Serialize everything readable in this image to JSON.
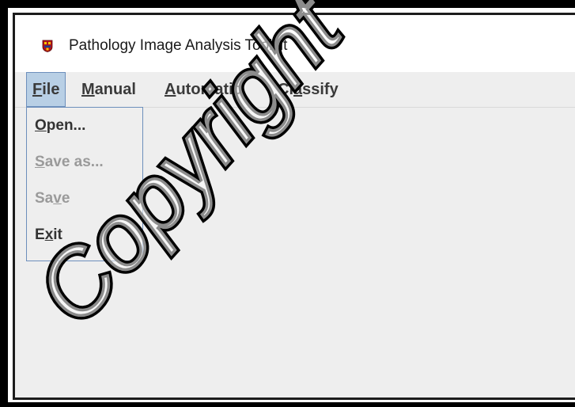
{
  "window": {
    "title": "Pathology Image Analysis Toolkit",
    "icon": "app-logo-icon"
  },
  "menubar": {
    "file": {
      "pre": "",
      "mnemonic": "F",
      "post": "ile"
    },
    "manual": {
      "pre": "",
      "mnemonic": "M",
      "post": "anual"
    },
    "automatic": {
      "pre": "",
      "mnemonic": "A",
      "post": "utomatic"
    },
    "classify": {
      "pre": "Cl",
      "mnemonic": "a",
      "post": "ssify"
    }
  },
  "file_menu": {
    "items": [
      {
        "pre": "",
        "mnemonic": "O",
        "post": "pen...",
        "enabled": true
      },
      {
        "pre": "",
        "mnemonic": "S",
        "post": "ave as...",
        "enabled": false
      },
      {
        "pre": "Sa",
        "mnemonic": "v",
        "post": "e",
        "enabled": false
      },
      {
        "pre": "E",
        "mnemonic": "x",
        "post": "it",
        "enabled": true
      }
    ]
  },
  "watermark": {
    "text": "Copyright"
  },
  "colors": {
    "menu_highlight": "#b8cfe5",
    "menu_border": "#6d8fbc",
    "background": "#eeeeee"
  }
}
